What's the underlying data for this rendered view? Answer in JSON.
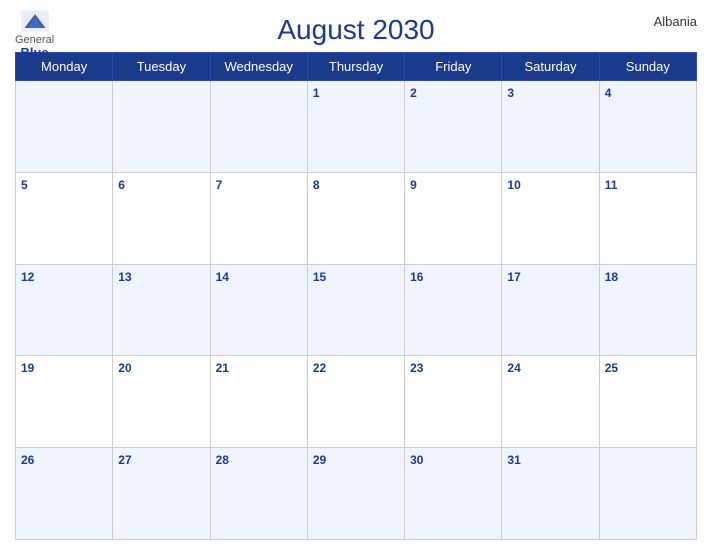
{
  "header": {
    "title": "August 2030",
    "country": "Albania",
    "logo": {
      "general": "General",
      "blue": "Blue"
    }
  },
  "weekdays": [
    "Monday",
    "Tuesday",
    "Wednesday",
    "Thursday",
    "Friday",
    "Saturday",
    "Sunday"
  ],
  "weeks": [
    [
      null,
      null,
      null,
      1,
      2,
      3,
      4
    ],
    [
      5,
      6,
      7,
      8,
      9,
      10,
      11
    ],
    [
      12,
      13,
      14,
      15,
      16,
      17,
      18
    ],
    [
      19,
      20,
      21,
      22,
      23,
      24,
      25
    ],
    [
      26,
      27,
      28,
      29,
      30,
      31,
      null
    ]
  ]
}
